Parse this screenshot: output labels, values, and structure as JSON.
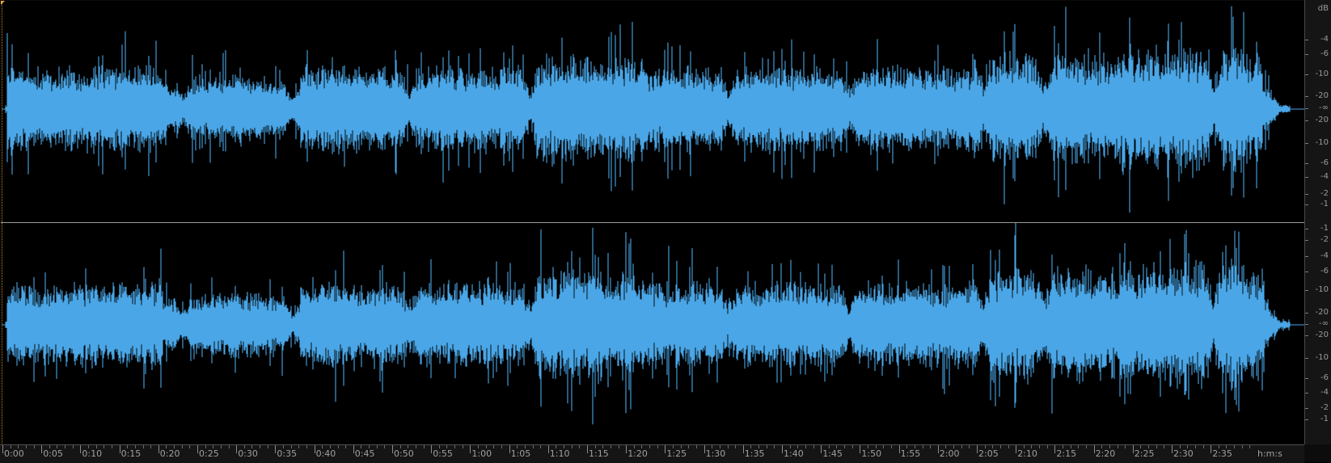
{
  "editor": {
    "waveform_color": "#4aa6e6",
    "background": "#000000",
    "channels": [
      "left",
      "right"
    ]
  },
  "db_ruler": {
    "unit": "dB",
    "left_channel": [
      "-4",
      "-6",
      "-10",
      "-20",
      "-∞",
      "-20",
      "-10",
      "-6",
      "-4",
      "-2",
      "-1"
    ],
    "right_channel": [
      "-1",
      "-2",
      "-4",
      "-6",
      "-10",
      "-20",
      "-∞",
      "-20",
      "-10",
      "-6",
      "-4",
      "-2",
      "-1"
    ]
  },
  "time_ruler": {
    "labels": [
      "0:00",
      "0:05",
      "0:10",
      "0:15",
      "0:20",
      "0:25",
      "0:30",
      "0:35",
      "0:40",
      "0:45",
      "0:50",
      "0:55",
      "1:00",
      "1:05",
      "1:10",
      "1:15",
      "1:20",
      "1:25",
      "1:30",
      "1:35",
      "1:40",
      "1:45",
      "1:50",
      "1:55",
      "2:00",
      "2:05",
      "2:10",
      "2:15",
      "2:20",
      "2:25",
      "2:30",
      "2:35"
    ],
    "unit": "h:m:s"
  }
}
